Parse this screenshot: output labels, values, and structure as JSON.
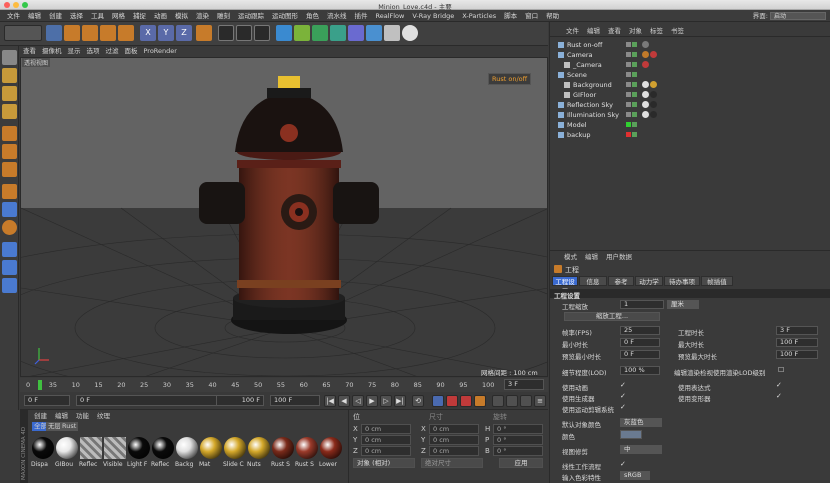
{
  "window": {
    "title": "Minion_Love.c4d - 主要"
  },
  "menubar": {
    "items": [
      "文件",
      "编辑",
      "创建",
      "选择",
      "工具",
      "网格",
      "捕捉",
      "动画",
      "模拟",
      "渲染",
      "雕刻",
      "运动跟踪",
      "运动图形",
      "角色",
      "流水线",
      "插件",
      "RealFlow",
      "V-Ray Bridge",
      "X-Particles",
      "脚本",
      "窗口",
      "帮助"
    ],
    "layout_label": "界面:",
    "layout_value": "启动"
  },
  "toolbar": {
    "axis_x": "X",
    "axis_y": "Y",
    "axis_z": "Z"
  },
  "viewport": {
    "menu": [
      "查看",
      "摄像机",
      "显示",
      "选项",
      "过滤",
      "面板",
      "ProRender"
    ],
    "view_label": "透视视图",
    "camera_tag": "Rust on/off",
    "grid_spacing": "网格间距 : 100 cm"
  },
  "timeline": {
    "ticks": [
      "0",
      "35",
      "10",
      "15",
      "20",
      "25",
      "30",
      "35",
      "40",
      "45",
      "50",
      "55",
      "60",
      "65",
      "70",
      "75",
      "80",
      "85",
      "90",
      "95",
      "100"
    ],
    "current_frame": "3 F",
    "start_field": "0 F",
    "start_field2": "0 F",
    "end_field": "100 F",
    "end_field2": "100 F"
  },
  "materials": {
    "menu": [
      "创建",
      "编辑",
      "功能",
      "纹理"
    ],
    "tabs": [
      "全部",
      "无层",
      "Rust"
    ],
    "items": [
      {
        "label": "Dispa",
        "color": "#0a0a0a"
      },
      {
        "label": "GIBou",
        "color": "#e8e8e8"
      },
      {
        "label": "Reflec",
        "color": "stripe"
      },
      {
        "label": "Visible",
        "color": "stripe"
      },
      {
        "label": "Light F",
        "color": "#0a0a0a"
      },
      {
        "label": "Reflec",
        "color": "#0a0a0a"
      },
      {
        "label": "Backg",
        "color": "#e0e0e0"
      },
      {
        "label": "Mat",
        "color": "#d4a82a"
      },
      {
        "label": "Slide C",
        "color": "#d4a82a"
      },
      {
        "label": "Nuts",
        "color": "#d4a82a"
      },
      {
        "label": "Rust S",
        "color": "#7a2a1a"
      },
      {
        "label": "Rust S",
        "color": "#9a3a2a"
      },
      {
        "label": "Lower",
        "color": "#8a2a1a"
      }
    ],
    "logo_text": "MAXON CINEMA 4D"
  },
  "coordinates": {
    "header_pos": "位",
    "header_size": "尺寸",
    "header_rot": "旋转",
    "rows": [
      {
        "axis": "X",
        "value": "0 cm",
        "axis2": "X",
        "value2": "0 cm",
        "axis3": "H",
        "value3": "0 °"
      },
      {
        "axis": "Y",
        "value": "0 cm",
        "axis2": "Y",
        "value2": "0 cm",
        "axis3": "P",
        "value3": "0 °"
      },
      {
        "axis": "Z",
        "value": "0 cm",
        "axis2": "Z",
        "value2": "0 cm",
        "axis3": "B",
        "value3": "0 °"
      }
    ],
    "mode_select": "对象 (相对)",
    "size_select": "绝对尺寸",
    "apply_button": "应用"
  },
  "object_manager": {
    "menu": [
      "文件",
      "编辑",
      "查看",
      "对象",
      "标签",
      "书签"
    ],
    "objects": [
      {
        "name": "Rust on-off",
        "indent": 1,
        "color": "#d0d0d0"
      },
      {
        "name": "Camera",
        "indent": 1,
        "color": "#d0d0d0"
      },
      {
        "name": "_Camera",
        "indent": 2,
        "color": "#d0d0d0"
      },
      {
        "name": "Scene",
        "indent": 1,
        "color": "#d0d0d0"
      },
      {
        "name": "Background",
        "indent": 2,
        "color": "#d0d0d0"
      },
      {
        "name": "GIFloor",
        "indent": 2,
        "color": "#d0d0d0"
      },
      {
        "name": "Reflection Sky",
        "indent": 1,
        "color": "#d0d0d0"
      },
      {
        "name": "Illumination Sky",
        "indent": 1,
        "color": "#d0d0d0"
      },
      {
        "name": "Model",
        "indent": 1,
        "color": "#d0d0d0"
      },
      {
        "name": "backup",
        "indent": 1,
        "color": "#d0d0d0"
      }
    ]
  },
  "attributes": {
    "menu": [
      "模式",
      "编辑",
      "用户数据"
    ],
    "title": "工程",
    "tabs": [
      "工程设置",
      "信息",
      "参考",
      "动力学",
      "待办事项",
      "帧插值"
    ],
    "section": "工程设置",
    "scale_label": "工程缩放",
    "scale_value": "1",
    "scale_unit": "厘米",
    "scale_button": "缩放工程...",
    "fps_label": "帧率(FPS)",
    "fps_value": "25",
    "min_time_label": "最小时长",
    "min_time_value": "0 F",
    "preview_min_label": "预览最小时长",
    "preview_min_value": "0 F",
    "lod_label": "细节程度(LOD)",
    "lod_value": "100 %",
    "project_time_label": "工程时长",
    "project_time_value": "3 F",
    "max_time_label": "最大时长",
    "max_time_value": "100 F",
    "preview_max_label": "预览最大时长",
    "preview_max_value": "100 F",
    "render_lod_label": "编辑渲染检视使用渲染LOD级别",
    "use_anim_label": "使用动画",
    "use_expr_label": "使用表达式",
    "use_gen_label": "使用生成器",
    "use_deform_label": "使用变形器",
    "use_motion_label": "使用运动剪辑系统",
    "default_color_label": "默认对象颜色",
    "default_color_value": "灰蓝色",
    "color_label": "颜色",
    "view_clip_label": "视图修剪",
    "view_clip_value": "中",
    "linear_label": "线性工作流程",
    "input_color_label": "输入色彩特性",
    "input_color_value": "sRGB"
  }
}
